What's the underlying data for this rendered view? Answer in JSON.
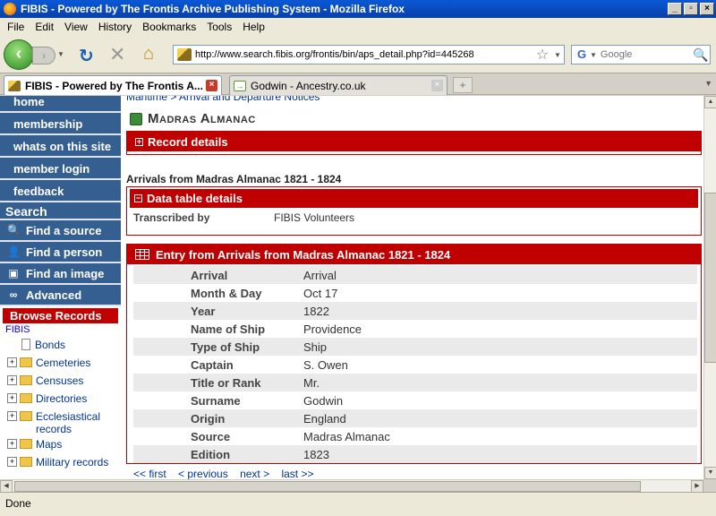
{
  "window": {
    "title": "FIBIS - Powered by The Frontis Archive Publishing System - Mozilla Firefox"
  },
  "menubar": [
    "File",
    "Edit",
    "View",
    "History",
    "Bookmarks",
    "Tools",
    "Help"
  ],
  "address": {
    "url": "http://www.search.fibis.org/frontis/bin/aps_detail.php?id=445268",
    "search_placeholder": "Google"
  },
  "tabs": [
    {
      "label": "FIBIS - Powered by The Frontis A...",
      "active": true
    },
    {
      "label": "Godwin - Ancestry.co.uk",
      "active": false
    }
  ],
  "sidebar": {
    "nav": [
      "home",
      "membership",
      "whats on this site",
      "member login",
      "feedback"
    ],
    "search_heading": "Search",
    "find": [
      {
        "label": "Find a source",
        "icon": "magnifier-icon"
      },
      {
        "label": "Find a person",
        "icon": "person-icon"
      },
      {
        "label": "Find an image",
        "icon": "image-icon"
      },
      {
        "label": "Advanced",
        "icon": "binoculars-icon"
      }
    ],
    "browse_heading": "Browse Records",
    "fibis_link": "FIBIS",
    "tree": [
      {
        "label": "Bonds",
        "type": "doc"
      },
      {
        "label": "Cemeteries",
        "type": "folder"
      },
      {
        "label": "Censuses",
        "type": "folder"
      },
      {
        "label": "Directories",
        "type": "folder"
      },
      {
        "label": "Ecclesiastical records",
        "type": "folder"
      },
      {
        "label": "Maps",
        "type": "folder"
      },
      {
        "label": "Military records",
        "type": "folder"
      }
    ]
  },
  "main": {
    "breadcrumb": "Maritime > Arrival and Departure Notices",
    "title": "Madras Almanac",
    "record_details": "Record details",
    "section_title": "Arrivals from Madras Almanac 1821 - 1824",
    "data_table_details": "Data table details",
    "transcribed_label": "Transcribed by",
    "transcribed_value": "FIBIS Volunteers",
    "entry_heading": "Entry from Arrivals from Madras Almanac 1821 - 1824",
    "entry_rows": [
      {
        "label": "Arrival",
        "value": "Arrival"
      },
      {
        "label": "Month & Day",
        "value": "Oct 17"
      },
      {
        "label": "Year",
        "value": "1822"
      },
      {
        "label": "Name of Ship",
        "value": "Providence"
      },
      {
        "label": "Type of Ship",
        "value": "Ship"
      },
      {
        "label": "Captain",
        "value": "S. Owen"
      },
      {
        "label": "Title or Rank",
        "value": "Mr."
      },
      {
        "label": "Surname",
        "value": "Godwin"
      },
      {
        "label": "Origin",
        "value": "England"
      },
      {
        "label": "Source",
        "value": "Madras Almanac"
      },
      {
        "label": "Edition",
        "value": "1823"
      }
    ],
    "pager": [
      "<< first",
      "< previous",
      "next >",
      "last >>"
    ]
  },
  "status": {
    "text": "Done"
  },
  "colors": {
    "sidebar_blue": "#365f91",
    "accent_red": "#c00000",
    "link_blue": "#003399"
  }
}
